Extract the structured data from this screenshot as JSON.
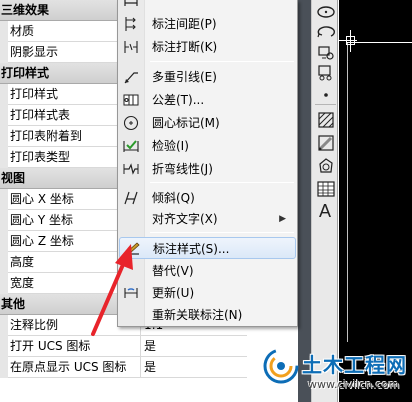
{
  "properties": {
    "sections": [
      {
        "category": "三维效果",
        "rows": [
          {
            "label": "材质",
            "value": ""
          },
          {
            "label": "阴影显示",
            "value": ""
          }
        ]
      },
      {
        "category": "打印样式",
        "rows": [
          {
            "label": "打印样式",
            "value": ""
          },
          {
            "label": "打印样式表",
            "value": ""
          },
          {
            "label": "打印表附着到",
            "value": ""
          },
          {
            "label": "打印表类型",
            "value": ""
          }
        ]
      },
      {
        "category": "视图",
        "rows": [
          {
            "label": "圆心 X 坐标",
            "value": ""
          },
          {
            "label": "圆心 Y 坐标",
            "value": ""
          },
          {
            "label": "圆心 Z 坐标",
            "value": ""
          },
          {
            "label": "高度",
            "value": ""
          },
          {
            "label": "宽度",
            "value": ""
          }
        ]
      },
      {
        "category": "其他",
        "rows": [
          {
            "label": "注释比例",
            "value": "1:1"
          },
          {
            "label": "打开 UCS 图标",
            "value": "是"
          },
          {
            "label": "在原点显示 UCS 图标",
            "value": "是"
          }
        ]
      }
    ]
  },
  "menu": {
    "items": [
      {
        "label": "标注间距(P)",
        "icon": "dim-space-icon"
      },
      {
        "label": "标注打断(K)",
        "icon": "dim-break-icon"
      },
      {
        "separator": true
      },
      {
        "label": "多重引线(E)",
        "icon": "multileader-icon"
      },
      {
        "label": "公差(T)...",
        "icon": "tolerance-icon"
      },
      {
        "label": "圆心标记(M)",
        "icon": "center-mark-icon"
      },
      {
        "label": "检验(I)",
        "icon": "inspection-icon"
      },
      {
        "label": "折弯线性(J)",
        "icon": "jogged-linear-icon"
      },
      {
        "separator": true
      },
      {
        "label": "倾斜(Q)",
        "icon": "oblique-icon"
      },
      {
        "label": "对齐文字(X)",
        "icon": "",
        "submenu": true
      },
      {
        "separator": true
      },
      {
        "label": "标注样式(S)...",
        "icon": "dim-style-icon",
        "highlighted": true
      },
      {
        "label": "替代(V)",
        "icon": ""
      },
      {
        "label": "更新(U)",
        "icon": "dim-update-icon"
      },
      {
        "label": "重新关联标注(N)",
        "icon": ""
      }
    ]
  },
  "toolbar": {
    "icons": [
      "ellipse-icon",
      "ellipse-arc-icon",
      "insert-block-icon",
      "make-block-icon",
      "point-icon",
      "hatch-icon",
      "gradient-icon",
      "region-icon",
      "table-icon",
      "mtext-icon"
    ]
  },
  "watermark": {
    "brand": "土木工程网",
    "url": "www.civilcn.com"
  },
  "colors": {
    "highlight_border": "#a8c8ee",
    "highlight_fill": "#dbe8f8",
    "annotation_arrow": "#e8242b",
    "watermark_brand": "#0d6db6",
    "model_space": "#000000"
  }
}
